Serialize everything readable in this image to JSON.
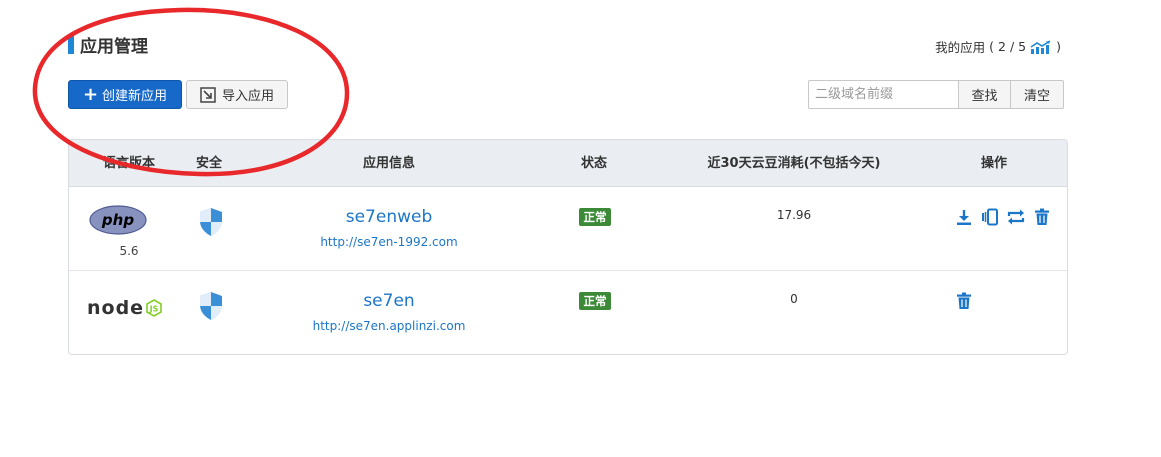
{
  "header": {
    "title": "应用管理",
    "quota_label": "我的应用",
    "quota_open": "(",
    "quota_value": "2 / 5",
    "quota_close": ")",
    "quota_icon": "chart-up-icon"
  },
  "toolbar": {
    "create_label": "创建新应用",
    "import_label": "导入应用",
    "search_placeholder": "二级域名前缀",
    "search_value": "",
    "find_label": "查找",
    "clear_label": "清空"
  },
  "table": {
    "columns": [
      "语言版本",
      "安全",
      "应用信息",
      "状态",
      "近30天云豆消耗(不包括今天)",
      "操作"
    ],
    "rows": [
      {
        "language": "php",
        "language_version": "5.6",
        "security_icon": "shield-icon",
        "app_name": "se7enweb",
        "app_url": "http://se7en-1992.com",
        "status": "正常",
        "usage": "17.96",
        "actions": [
          "download-icon",
          "mobile-icon",
          "sync-icon",
          "trash-icon"
        ]
      },
      {
        "language": "node",
        "language_version": "",
        "security_icon": "shield-icon",
        "app_name": "se7en",
        "app_url": "http://se7en.applinzi.com",
        "status": "正常",
        "usage": "0",
        "actions": [
          "trash-icon"
        ]
      }
    ]
  },
  "colors": {
    "primary": "#1669c9",
    "link": "#1c76c8",
    "status_ok": "#3c8a38",
    "annotation_circle": "#e8282b"
  }
}
